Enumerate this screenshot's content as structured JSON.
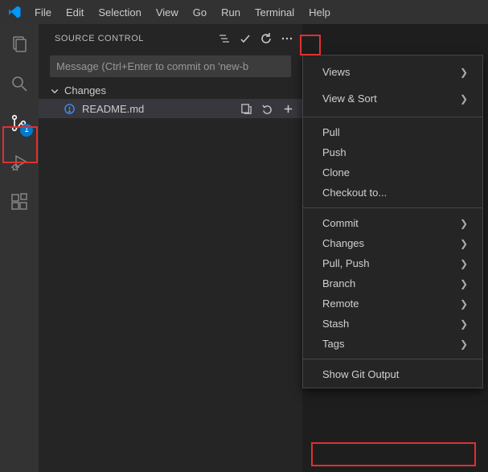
{
  "menubar": {
    "items": [
      "File",
      "Edit",
      "Selection",
      "View",
      "Go",
      "Run",
      "Terminal",
      "Help"
    ]
  },
  "activitybar": {
    "scm_badge": "1"
  },
  "sidebar": {
    "title": "SOURCE CONTROL",
    "commit_placeholder": "Message (Ctrl+Enter to commit on 'new-b",
    "section": "Changes",
    "files": [
      {
        "name": "README.md"
      }
    ]
  },
  "context_menu": {
    "groups": [
      [
        {
          "label": "Views",
          "submenu": true
        },
        {
          "label": "View & Sort",
          "submenu": true
        }
      ],
      [
        {
          "label": "Pull",
          "submenu": false
        },
        {
          "label": "Push",
          "submenu": false
        },
        {
          "label": "Clone",
          "submenu": false
        },
        {
          "label": "Checkout to...",
          "submenu": false
        }
      ],
      [
        {
          "label": "Commit",
          "submenu": true
        },
        {
          "label": "Changes",
          "submenu": true
        },
        {
          "label": "Pull, Push",
          "submenu": true
        },
        {
          "label": "Branch",
          "submenu": true
        },
        {
          "label": "Remote",
          "submenu": true
        },
        {
          "label": "Stash",
          "submenu": true
        },
        {
          "label": "Tags",
          "submenu": true
        }
      ],
      [
        {
          "label": "Show Git Output",
          "submenu": false
        }
      ]
    ]
  }
}
